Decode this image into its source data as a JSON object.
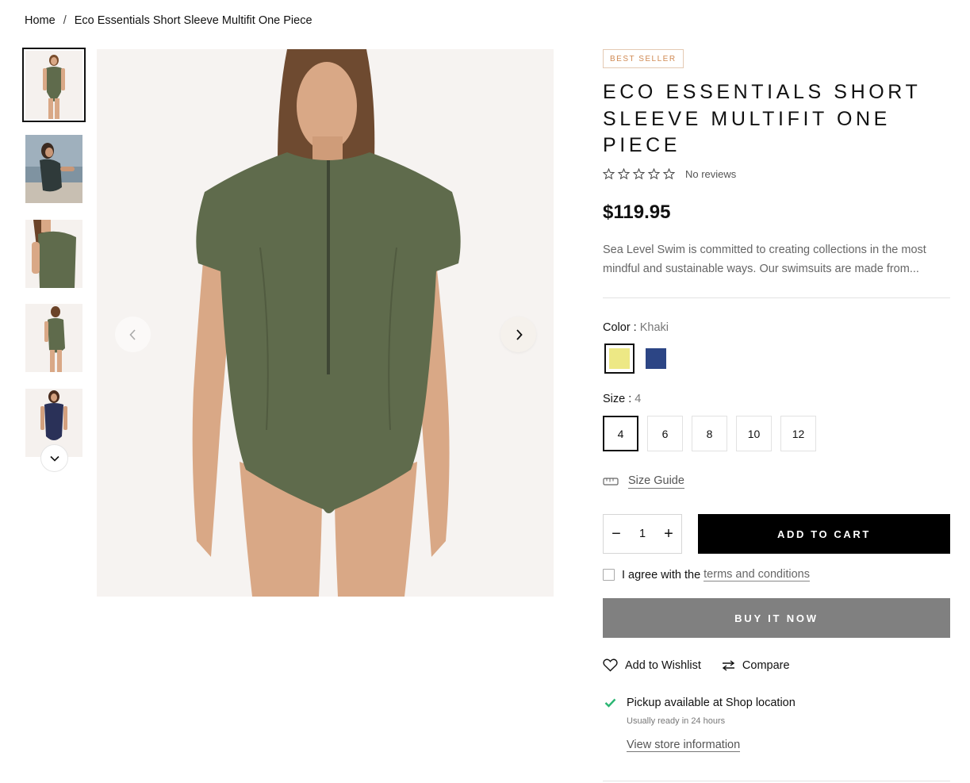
{
  "breadcrumb": {
    "home": "Home",
    "separator": "/",
    "current": "Eco Essentials Short Sleeve Multifit One Piece"
  },
  "gallery": {
    "thumbnails": [
      "thumb-1",
      "thumb-2",
      "thumb-3",
      "thumb-4",
      "thumb-5"
    ],
    "active_index": 0,
    "prev_icon": "chevron-left-icon",
    "next_icon": "chevron-right-icon",
    "more_icon": "chevron-down-icon"
  },
  "product": {
    "badge": "BEST SELLER",
    "title": "ECO ESSENTIALS SHORT SLEEVE MULTIFIT ONE PIECE",
    "reviews_text": "No reviews",
    "rating": 0,
    "price": "$119.95",
    "description": "Sea Level Swim is committed to creating collections in the most mindful and sustainable ways. Our swimsuits are made from..."
  },
  "color": {
    "label": "Color :",
    "value": "Khaki",
    "swatches": [
      {
        "name": "Khaki",
        "hex": "#ede885",
        "selected": true
      },
      {
        "name": "Navy",
        "hex": "#2c4585",
        "selected": false
      }
    ]
  },
  "size": {
    "label": "Size :",
    "value": "4",
    "options": [
      "4",
      "6",
      "8",
      "10",
      "12"
    ],
    "selected": "4"
  },
  "size_guide": {
    "label": "Size Guide",
    "icon": "ruler-icon"
  },
  "cart": {
    "quantity": "1",
    "minus": "−",
    "plus": "+",
    "add_to_cart": "ADD TO CART",
    "agree_prefix": "I agree with the",
    "agree_link": "terms and conditions",
    "buy_now": "BUY IT NOW"
  },
  "actions": {
    "wishlist": "Add to Wishlist",
    "compare": "Compare"
  },
  "pickup": {
    "text": "Pickup available at Shop location",
    "sub": "Usually ready in 24 hours",
    "store_link": "View store information"
  },
  "colors": {
    "accent_badge": "#d08a54",
    "button_primary": "#000000",
    "button_disabled": "#808080",
    "check_green": "#2bb673",
    "garment": "#5f6b4c"
  }
}
